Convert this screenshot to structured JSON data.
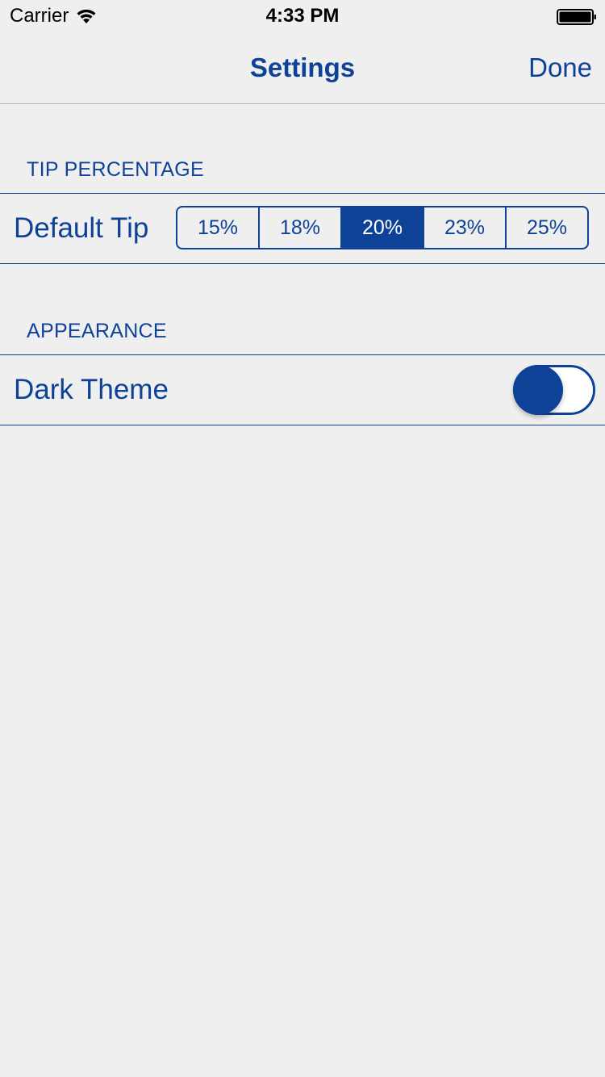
{
  "status_bar": {
    "carrier": "Carrier",
    "wifi_icon": "wifi-icon",
    "time": "4:33 PM",
    "battery_icon": "battery-icon",
    "battery_level": 1.0
  },
  "nav": {
    "title": "Settings",
    "done_label": "Done"
  },
  "tip_section": {
    "header": "TIP PERCENTAGE",
    "row_label": "Default Tip",
    "options": [
      "15%",
      "18%",
      "20%",
      "23%",
      "25%"
    ],
    "selected_index": 2,
    "selected_value": "20%"
  },
  "appearance_section": {
    "header": "APPEARANCE",
    "row_label": "Dark Theme",
    "toggle_on": false
  },
  "colors": {
    "accent": "#0d4297",
    "background": "#efefef",
    "separator": "#b3b3b3",
    "toggle_track": "#ffffff"
  }
}
